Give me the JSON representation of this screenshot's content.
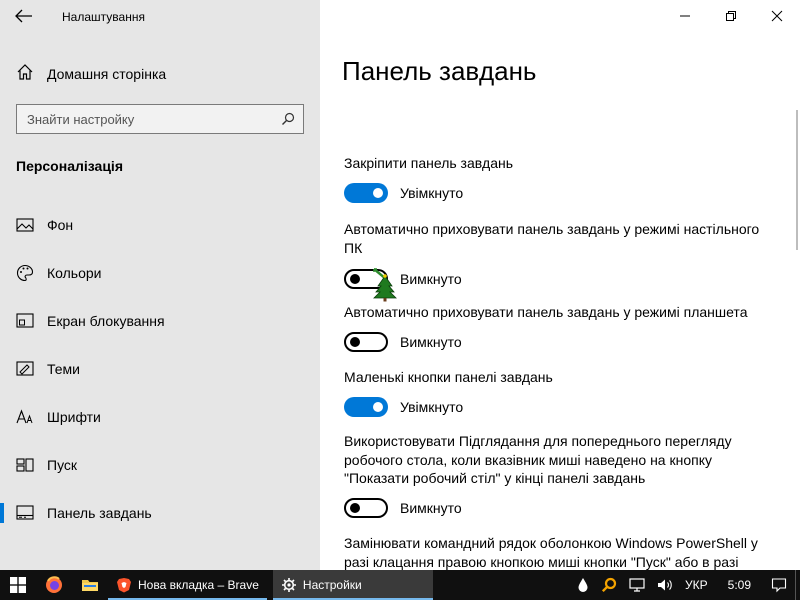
{
  "window": {
    "app_title": "Налаштування"
  },
  "sidebar": {
    "home_label": "Домашня сторінка",
    "search_placeholder": "Знайти настройку",
    "section_title": "Персоналізація",
    "items": [
      {
        "label": "Фон",
        "icon": "picture-icon"
      },
      {
        "label": "Кольори",
        "icon": "palette-icon"
      },
      {
        "label": "Екран блокування",
        "icon": "lock-screen-icon"
      },
      {
        "label": "Теми",
        "icon": "themes-icon"
      },
      {
        "label": "Шрифти",
        "icon": "font-icon"
      },
      {
        "label": "Пуск",
        "icon": "start-icon"
      },
      {
        "label": "Панель завдань",
        "icon": "taskbar-icon",
        "active": true
      }
    ]
  },
  "main": {
    "title": "Панель завдань",
    "settings": [
      {
        "label": "Закріпити панель завдань",
        "state": "Увімкнуто",
        "on": true
      },
      {
        "label": "Автоматично приховувати панель завдань у режимі настільного ПК",
        "state": "Вимкнуто",
        "on": false
      },
      {
        "label": "Автоматично приховувати панель завдань у режимі планшета",
        "state": "Вимкнуто",
        "on": false
      },
      {
        "label": "Маленькі кнопки панелі завдань",
        "state": "Увімкнуто",
        "on": true
      },
      {
        "label": "Використовувати Підглядання для попереднього перегляду робочого стола, коли вказівник миші наведено на кнопку \"Показати робочий стіл\" у кінці панелі завдань",
        "state": "Вимкнуто",
        "on": false
      },
      {
        "label": "Замінювати командний рядок оболонкою Windows PowerShell у разі клацання правою кнопкою миші кнопки \"Пуск\" або в разі"
      }
    ]
  },
  "taskbar": {
    "apps": [
      {
        "label": "Нова вкладка – Brave",
        "icon": "brave-icon"
      },
      {
        "label": "Настройки",
        "icon": "gear-icon",
        "active": true
      }
    ],
    "language": "УКР",
    "time": "5:09"
  },
  "colors": {
    "accent": "#0078d7",
    "sidebar_bg": "#e6e6e6",
    "taskbar_bg": "#101010"
  }
}
